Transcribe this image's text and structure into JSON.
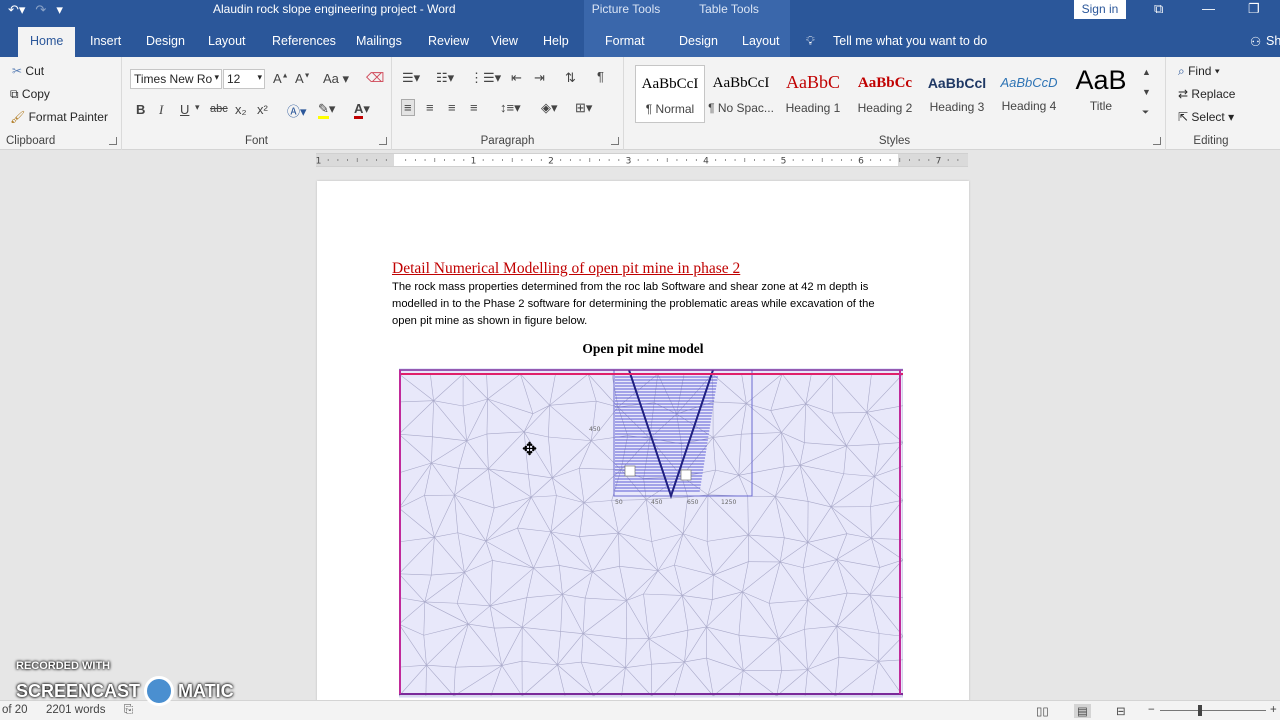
{
  "window": {
    "title": "Alaudin rock slope engineering project  -  Word",
    "context_picture": "Picture Tools",
    "context_table": "Table Tools",
    "sign_in": "Sign in"
  },
  "tabs": [
    "Home",
    "Insert",
    "Design",
    "Layout",
    "References",
    "Mailings",
    "Review",
    "View",
    "Help",
    "Format",
    "Design",
    "Layout"
  ],
  "tell_me": "Tell me what you want to do",
  "share": "Sh",
  "clipboard": {
    "label": "Clipboard",
    "cut": "Cut",
    "copy": "Copy",
    "format_painter": "Format Painter"
  },
  "font": {
    "label": "Font",
    "name": "Times New Ro",
    "size": "12",
    "bold": "B",
    "italic": "I",
    "underline": "U",
    "strike": "abc",
    "sub": "x₂",
    "sup": "x²",
    "change_case": "Aa"
  },
  "paragraph": {
    "label": "Paragraph"
  },
  "styles": {
    "label": "Styles",
    "items": [
      {
        "preview": "AaBbCcI",
        "name": "¶ Normal"
      },
      {
        "preview": "AaBbCcI",
        "name": "¶ No Spac..."
      },
      {
        "preview": "AaBbC",
        "name": "Heading 1"
      },
      {
        "preview": "AaBbCc",
        "name": "Heading 2"
      },
      {
        "preview": "AaBbCcl",
        "name": "Heading 3"
      },
      {
        "preview": "AaBbCcD",
        "name": "Heading 4"
      },
      {
        "preview": "AaB",
        "name": "Title"
      }
    ]
  },
  "editing": {
    "label": "Editing",
    "find": "Find",
    "replace": "Replace",
    "select": "Select"
  },
  "ruler": {
    "numbers": [
      "1",
      "1",
      "2",
      "3",
      "4",
      "5",
      "6",
      "7"
    ]
  },
  "document": {
    "heading": "Detail Numerical Modelling of open pit mine in phase 2",
    "paragraph": "The rock mass properties determined from the roc lab Software and shear zone at 42 m depth is modelled in to the Phase 2 software for determining the problematic areas while excavation of the open pit mine as shown in figure below.",
    "caption": "Open pit mine model",
    "figure_labels": [
      "450",
      "50",
      "450",
      "650",
      "1250"
    ]
  },
  "status": {
    "page": "of 20",
    "words": "2201 words"
  },
  "watermark": {
    "line1": "RECORDED WITH",
    "line2": "SCREENCAST",
    "line3": "MATIC"
  },
  "colors": {
    "accent": "#2b579a",
    "heading": "#c00000",
    "heading1_style": "#c00000",
    "heading3_style": "#1f3864",
    "heading4_style": "#2e74b5",
    "mesh": "#5b5bd6"
  }
}
